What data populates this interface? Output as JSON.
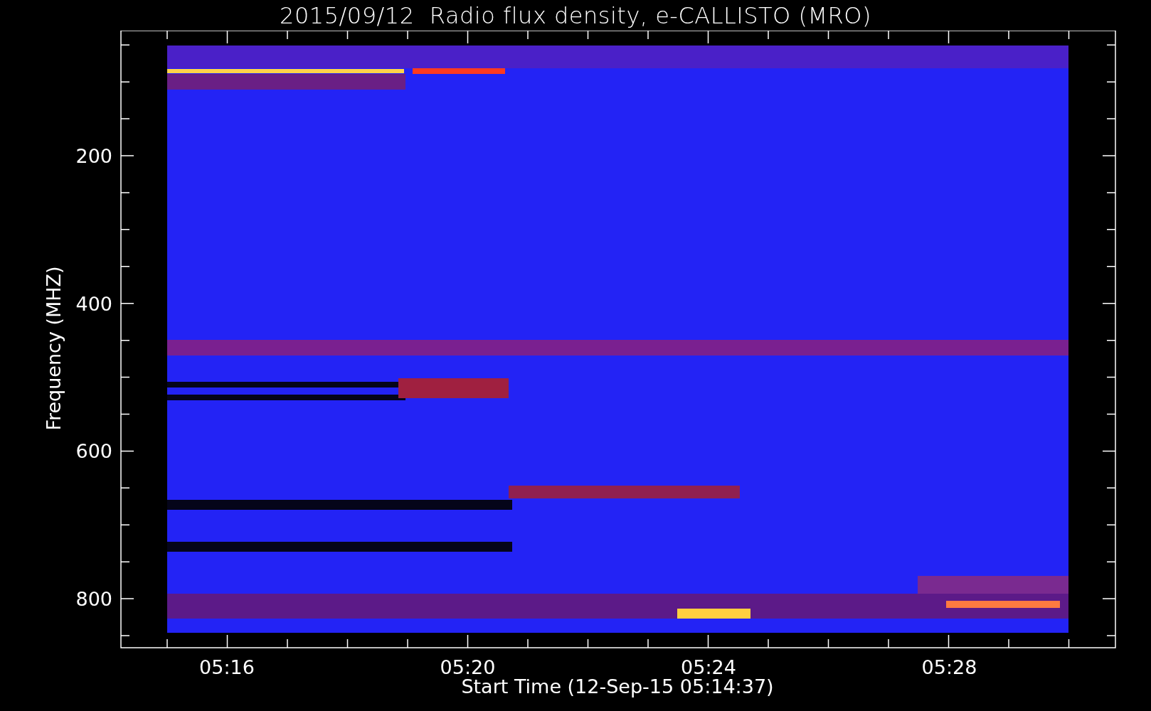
{
  "title": "2015/09/12  Radio flux density, e-CALLISTO (MRO)",
  "y_axis": {
    "label": "Frequency (MHZ)",
    "ticks": [
      "200",
      "400",
      "600",
      "800"
    ]
  },
  "x_axis": {
    "label": "Start Time (12-Sep-15 05:14:37)",
    "ticks": [
      "05:16",
      "05:20",
      "05:24",
      "05:28"
    ]
  }
}
